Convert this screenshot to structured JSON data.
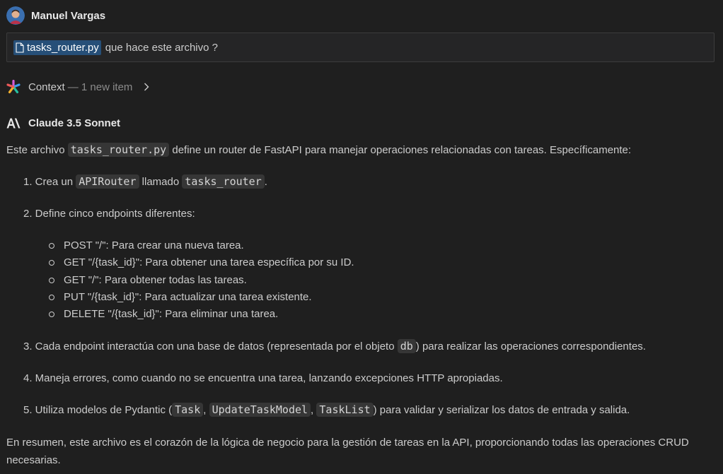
{
  "user": {
    "name": "Manuel Vargas"
  },
  "prompt": {
    "file_chip": "tasks_router.py",
    "text": "que hace este archivo ?"
  },
  "context": {
    "label": "Context",
    "count": "— 1 new item"
  },
  "assistant": {
    "name": "Claude 3.5 Sonnet"
  },
  "response": {
    "intro": {
      "a": "Este archivo ",
      "code": "tasks_router.py",
      "b": " define un router de FastAPI para manejar operaciones relacionadas con tareas. Específicamente:"
    },
    "step1": {
      "num": "1.",
      "a": " Crea un ",
      "code1": "APIRouter",
      "b": " llamado ",
      "code2": "tasks_router",
      "c": "."
    },
    "step2": {
      "num": "2.",
      "text": " Define cinco endpoints diferentes:"
    },
    "endpoints": [
      "POST \"/\": Para crear una nueva tarea.",
      "GET \"/{task_id}\": Para obtener una tarea específica por su ID.",
      "GET \"/\": Para obtener todas las tareas.",
      "PUT \"/{task_id}\": Para actualizar una tarea existente.",
      "DELETE \"/{task_id}\": Para eliminar una tarea."
    ],
    "step3": {
      "num": "3.",
      "a": " Cada endpoint interactúa con una base de datos (representada por el objeto ",
      "code": "db",
      "b": ") para realizar las operaciones correspondientes."
    },
    "step4": {
      "num": "4.",
      "text": " Maneja errores, como cuando no se encuentra una tarea, lanzando excepciones HTTP apropiadas."
    },
    "step5": {
      "num": "5.",
      "a": " Utiliza modelos de Pydantic (",
      "code1": "Task",
      "sep1": ", ",
      "code2": "UpdateTaskModel",
      "sep2": ", ",
      "code3": "TaskList",
      "b": ") para validar y serializar los datos de entrada y salida."
    },
    "summary": "En resumen, este archivo es el corazón de la lógica de negocio para la gestión de tareas en la API, proporcionando todas las operaciones CRUD necesarias."
  }
}
